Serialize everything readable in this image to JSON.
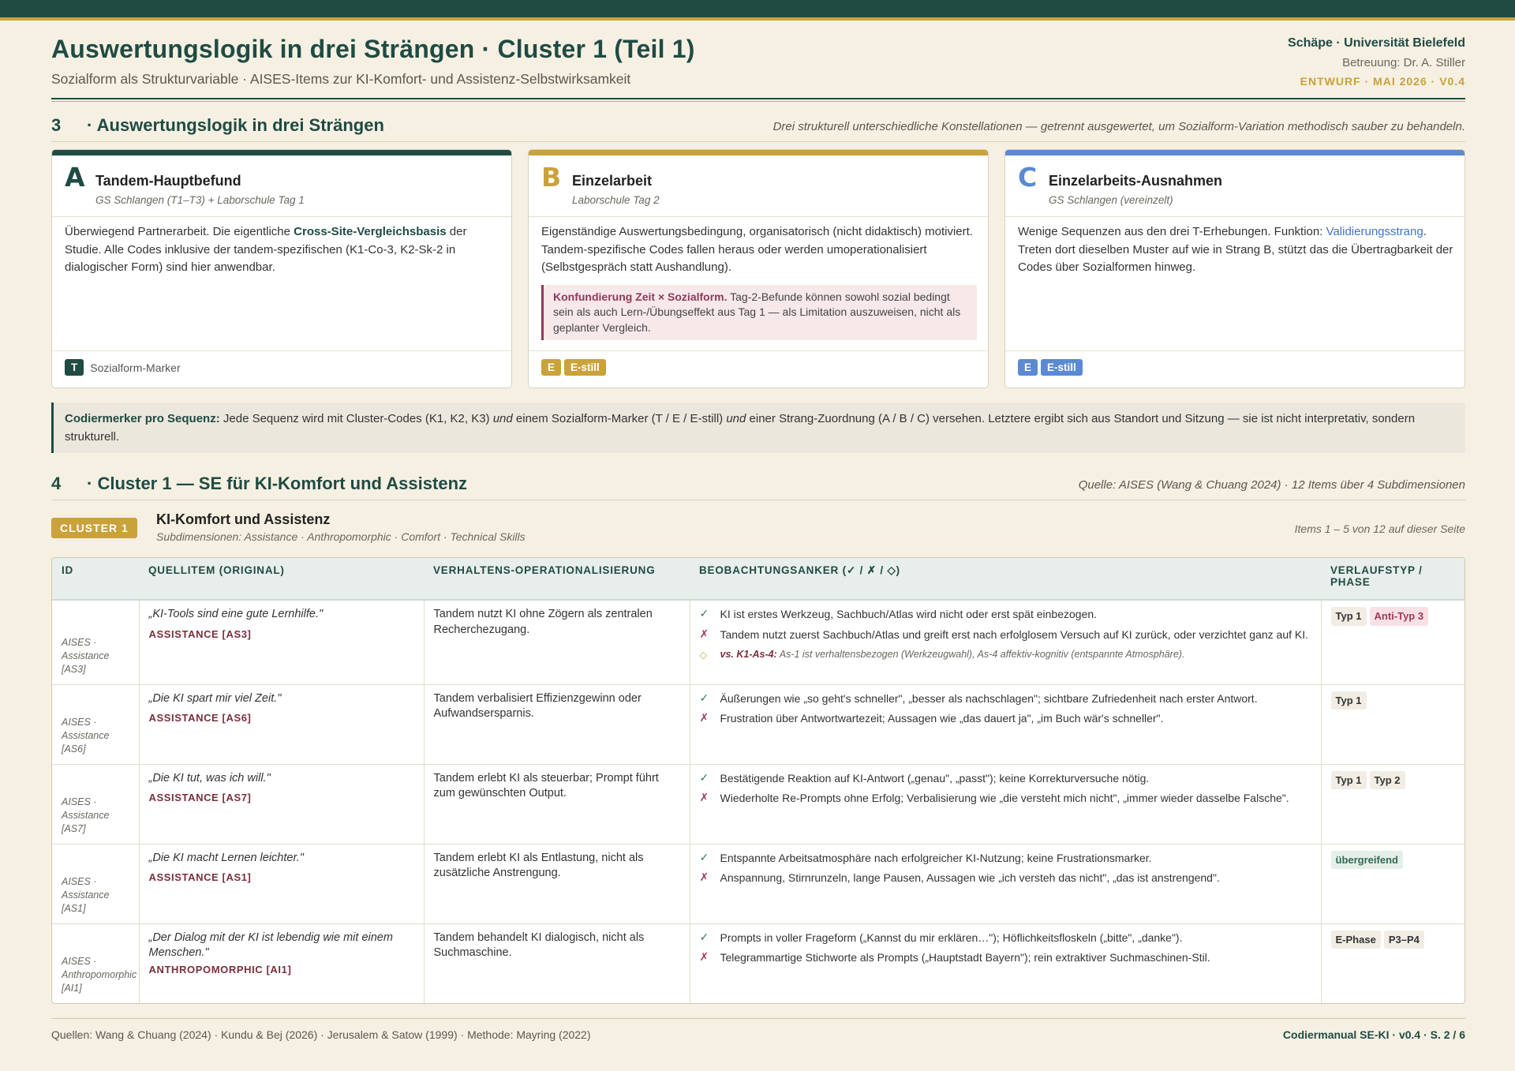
{
  "header": {
    "title": "Auswertungslogik in drei Strängen · Cluster 1 (Teil 1)",
    "subtitle": "Sozialform als Strukturvariable · AISES-Items zur KI-Komfort- und Assistenz-Selbstwirksamkeit",
    "author": "Schäpe · Universität Bielefeld",
    "supervision": "Betreuung: Dr. A. Stiller",
    "version": "ENTWURF · MAI 2026 · V0.4"
  },
  "section3": {
    "number": "3",
    "title": "· Auswertungslogik in drei Strängen",
    "note": "Drei strukturell unterschiedliche Konstellationen — getrennt ausgewertet, um Sozialform-Variation methodisch sauber zu behandeln."
  },
  "cards": {
    "a": {
      "letter": "A",
      "title": "Tandem-Hauptbefund",
      "subtitle": "GS Schlangen (T1–T3) + Laborschule Tag 1",
      "body_1": "Überwiegend Partnerarbeit. Die eigentliche ",
      "body_hl": "Cross-Site-Vergleichsbasis",
      "body_2": " der Studie. Alle Codes inklusive der tandem-spezifischen (K1-Co-3, K2-Sk-2 in dialogischer Form) sind hier anwendbar.",
      "tag": "T",
      "tag_label": "Sozialform-Marker"
    },
    "b": {
      "letter": "B",
      "title": "Einzelarbeit",
      "subtitle": "Laborschule Tag 2",
      "body": "Eigenständige Auswertungsbedingung, organisatorisch (nicht didaktisch) motiviert. Tandem-spezifische Codes fallen heraus oder werden umoperationalisiert (Selbstgespräch statt Aushandlung).",
      "note_bold": "Konfundierung Zeit × Sozialform.",
      "note_text": " Tag-2-Befunde können sowohl sozial bedingt sein als auch Lern-/Übungseffekt aus Tag 1 — als Limitation auszuweisen, nicht als geplanter Vergleich.",
      "tag1": "E",
      "tag2": "E-still"
    },
    "c": {
      "letter": "C",
      "title": "Einzelarbeits-Ausnahmen",
      "subtitle": "GS Schlangen (vereinzelt)",
      "body_1": "Wenige Sequenzen aus den drei T-Erhebungen. Funktion: ",
      "body_hl": "Validierungsstrang",
      "body_2": ". Treten dort dieselben Muster auf wie in Strang B, stützt das die Übertragbarkeit der Codes über Sozialformen hinweg.",
      "tag1": "E",
      "tag2": "E-still"
    }
  },
  "codiermerker": {
    "label": "Codiermerker pro Sequenz:",
    "t1": " Jede Sequenz wird mit Cluster-Codes (K1, K2, K3) ",
    "i1": "und",
    "t2": " einem Sozialform-Marker (T / E / E-still) ",
    "i2": "und",
    "t3": " einer Strang-Zuordnung (A / B / C) versehen. Letztere ergibt sich aus Standort und Sitzung — sie ist nicht interpretativ, sondern strukturell."
  },
  "section4": {
    "number": "4",
    "title": "· Cluster 1 — SE für KI-Komfort und Assistenz",
    "note": "Quelle: AISES (Wang & Chuang 2024) · 12 Items über 4 Subdimensionen"
  },
  "cluster": {
    "badge": "CLUSTER 1",
    "title": "KI-Komfort und Assistenz",
    "subtitle": "Subdimensionen: Assistance · Anthropomorphic · Comfort · Technical Skills",
    "items_note": "Items 1 – 5 von 12 auf dieser Seite"
  },
  "table": {
    "headers": [
      "ID",
      "QUELLITEM (ORIGINAL)",
      "VERHALTENS-OPERATIONALISIERUNG",
      "BEOBACHTUNGSANKER (✓ / ✗ / ◇)",
      "VERLAUFSTYP / PHASE"
    ],
    "rows": [
      {
        "id": "AISES · Assistance [AS3]",
        "quote": "„KI-Tools sind eine gute Lernhilfe.\"",
        "code": "ASSISTANCE [AS3]",
        "op": "Tandem nutzt KI ohne Zögern als zentralen Recherchezugang.",
        "pos": "KI ist erstes Werkzeug, Sachbuch/Atlas wird nicht oder erst spät einbezogen.",
        "neg": "Tandem nutzt zuerst Sachbuch/Atlas und greift erst nach erfolglosem Versuch auf KI zurück, oder verzichtet ganz auf KI.",
        "vs_bold": "vs. K1-As-4:",
        "vs_text": " As-1 ist verhaltensbezogen (Werkzeugwahl), As-4 affektiv-kognitiv (entspannte Atmosphäre).",
        "p1": "Typ 1",
        "p2": "Anti-Typ 3"
      },
      {
        "id": "AISES · Assistance [AS6]",
        "quote": "„Die KI spart mir viel Zeit.\"",
        "code": "ASSISTANCE [AS6]",
        "op": "Tandem verbalisiert Effizienzgewinn oder Aufwandsersparnis.",
        "pos": "Äußerungen wie „so geht's schneller\", „besser als nachschlagen\"; sichtbare Zufriedenheit nach erster Antwort.",
        "neg": "Frustration über Antwortwartezeit; Aussagen wie „das dauert ja\", „im Buch wär's schneller\".",
        "p1": "Typ 1"
      },
      {
        "id": "AISES · Assistance [AS7]",
        "quote": "„Die KI tut, was ich will.\"",
        "code": "ASSISTANCE [AS7]",
        "op": "Tandem erlebt KI als steuerbar; Prompt führt zum gewünschten Output.",
        "pos": "Bestätigende Reaktion auf KI-Antwort („genau\", „passt\"); keine Korrekturversuche nötig.",
        "neg": "Wiederholte Re-Prompts ohne Erfolg; Verbalisierung wie „die versteht mich nicht\", „immer wieder dasselbe Falsche\".",
        "p1": "Typ 1",
        "p2": "Typ 2"
      },
      {
        "id": "AISES · Assistance [AS1]",
        "quote": "„Die KI macht Lernen leichter.\"",
        "code": "ASSISTANCE [AS1]",
        "op": "Tandem erlebt KI als Entlastung, nicht als zusätzliche Anstrengung.",
        "pos": "Entspannte Arbeitsatmosphäre nach erfolgreicher KI-Nutzung; keine Frustrationsmarker.",
        "neg": "Anspannung, Stirnrunzeln, lange Pausen, Aussagen wie „ich versteh das nicht\", „das ist anstrengend\".",
        "p1": "übergreifend"
      },
      {
        "id": "AISES · Anthropomorphic [AI1]",
        "quote": "„Der Dialog mit der KI ist lebendig wie mit einem Menschen.\"",
        "code": "ANTHROPOMORPHIC [AI1]",
        "op": "Tandem behandelt KI dialogisch, nicht als Suchmaschine.",
        "pos": "Prompts in voller Frageform („Kannst du mir erklären…\"); Höflichkeitsfloskeln („bitte\", „danke\").",
        "neg": "Telegrammartige Stichworte als Prompts („Hauptstadt Bayern\"); rein extraktiver Suchmaschinen-Stil.",
        "p1": "E-Phase",
        "p2": "P3–P4"
      }
    ],
    "icons": {
      "pos": "check-icon",
      "neg": "cross-icon",
      "vs": "diamond-icon"
    }
  },
  "footer": {
    "sources": "Quellen: Wang & Chuang (2024) · Kundu & Bej (2026) · Jerusalem & Satow (1999) · Methode: Mayring (2022)",
    "page": "Codiermanual SE-KI · v0.4 · S. 2 / 6"
  },
  "colors": {
    "primary": "#1f4b43",
    "gold": "#c9a23a",
    "blue": "#5b8ad3",
    "red": "#a23a55"
  }
}
